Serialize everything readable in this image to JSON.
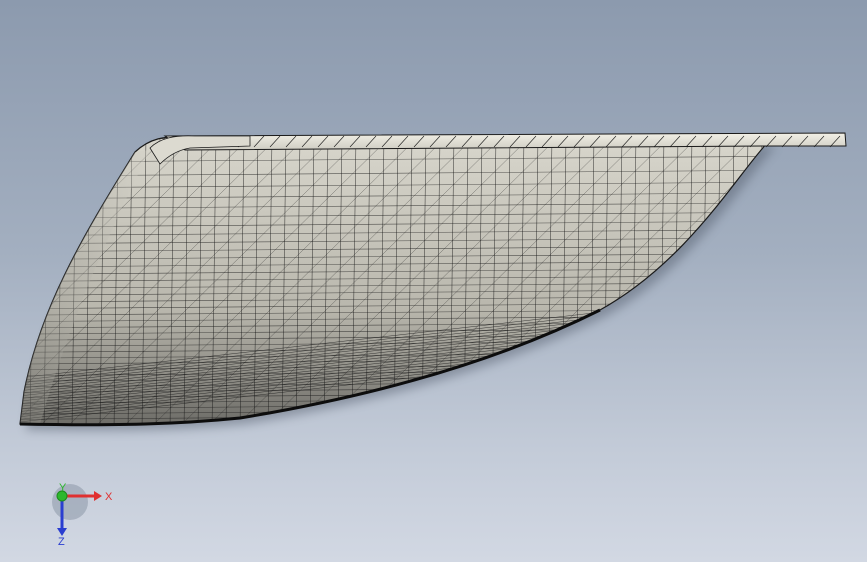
{
  "viewport": {
    "background_top": "#8c9aae",
    "background_bottom": "#d2d8e3",
    "model": {
      "display_mode": "wireframe-shaded",
      "face_color": "#e8e6dc",
      "edge_color": "#1a1a1a",
      "shadow_color": "#5c6575"
    }
  },
  "triad": {
    "x_label": "X",
    "y_label": "Y",
    "z_label": "Z",
    "x_color": "#e03030",
    "y_color": "#2db82d",
    "z_color": "#2a3ed0"
  }
}
